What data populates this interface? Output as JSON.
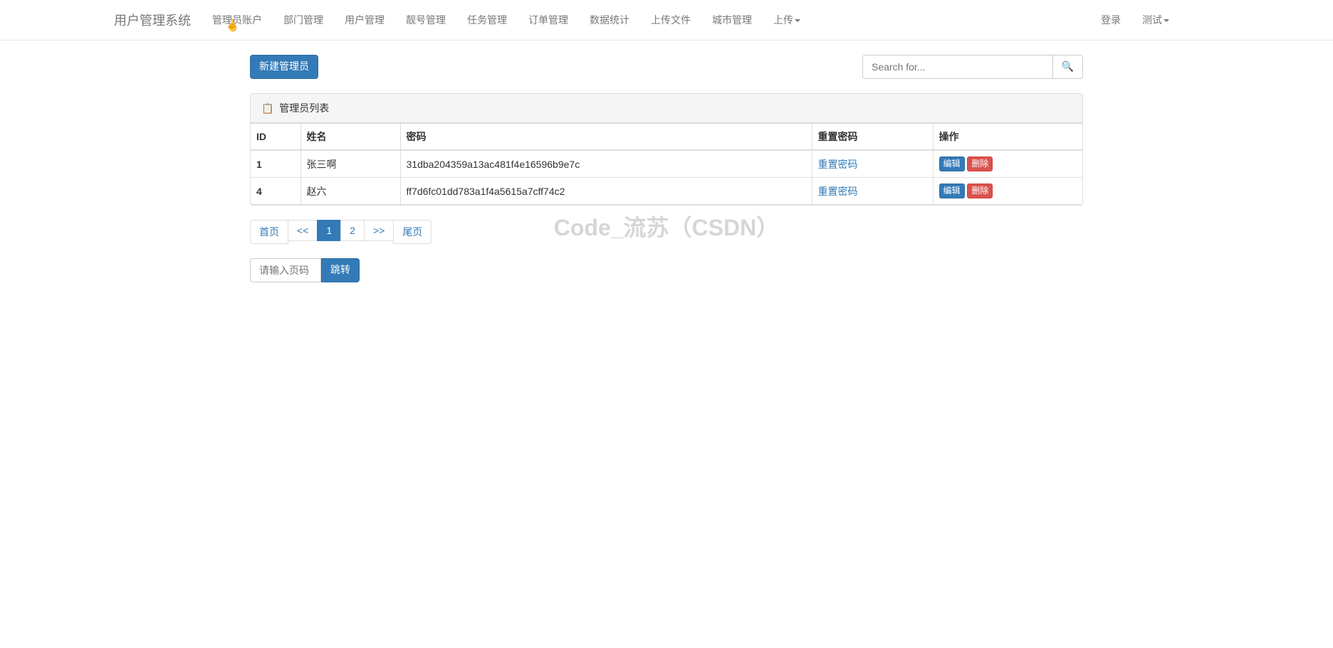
{
  "brand": "用户管理系统",
  "nav_left": [
    {
      "label": "管理员账户"
    },
    {
      "label": "部门管理"
    },
    {
      "label": "用户管理"
    },
    {
      "label": "靓号管理"
    },
    {
      "label": "任务管理"
    },
    {
      "label": "订单管理"
    },
    {
      "label": "数据统计"
    },
    {
      "label": "上传文件"
    },
    {
      "label": "城市管理"
    },
    {
      "label": "上传",
      "dropdown": true
    }
  ],
  "nav_right": [
    {
      "label": "登录"
    },
    {
      "label": "测试",
      "dropdown": true
    }
  ],
  "buttons": {
    "new_admin": "新建管理员",
    "jump": "跳转",
    "edit": "编辑",
    "delete": "删除"
  },
  "search": {
    "placeholder": "Search for...",
    "icon": "🔍"
  },
  "panel": {
    "title": "管理员列表",
    "icon": "📋"
  },
  "table": {
    "headers": {
      "id": "ID",
      "name": "姓名",
      "password": "密码",
      "reset": "重置密码",
      "operation": "操作"
    },
    "rows": [
      {
        "id": "1",
        "name": "张三啊",
        "password": "31dba204359a13ac481f4e16596b9e7c",
        "reset_label": "重置密码"
      },
      {
        "id": "4",
        "name": "赵六",
        "password": "ff7d6fc01dd783a1f4a5615a7cff74c2",
        "reset_label": "重置密码"
      }
    ]
  },
  "pagination": {
    "first": "首页",
    "prev": "<<",
    "pages": [
      "1",
      "2"
    ],
    "active_index": 0,
    "next": ">>",
    "last": "尾页"
  },
  "jump": {
    "placeholder": "请输入页码"
  },
  "watermark": "Code_流苏（CSDN）"
}
